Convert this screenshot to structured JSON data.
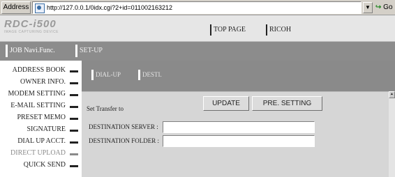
{
  "browser": {
    "address_label": "Address",
    "url": "http://127.0.0.1/0idx.cgi?2+id=011002163212",
    "go_label": "Go"
  },
  "header": {
    "logo_text": "RDC-i500",
    "logo_subtext": "IMAGE CAPTURING DEVICE",
    "links": [
      "TOP PAGE",
      "RICOH"
    ]
  },
  "nav": {
    "items": [
      "JOB Navi.Func.",
      "SET-UP"
    ]
  },
  "sidebar": {
    "items": [
      {
        "label": "ADDRESS BOOK",
        "enabled": true
      },
      {
        "label": "OWNER INFO.",
        "enabled": true
      },
      {
        "label": "MODEM SETTING",
        "enabled": true
      },
      {
        "label": "E-MAIL SETTING",
        "enabled": true
      },
      {
        "label": "PRESET MEMO",
        "enabled": true
      },
      {
        "label": "SIGNATURE",
        "enabled": true
      },
      {
        "label": "DIAL UP ACCT.",
        "enabled": true
      },
      {
        "label": "DIRECT UPLOAD",
        "enabled": false
      },
      {
        "label": "QUICK SEND",
        "enabled": true
      }
    ]
  },
  "content": {
    "subtabs": [
      "DIAL-UP",
      "DESTI."
    ],
    "transfer_label": "Set Transfer to",
    "buttons": {
      "update": "UPDATE",
      "pre_setting": "PRE. SETTING"
    },
    "fields": [
      {
        "label": "DESTINATION SERVER :",
        "value": "",
        "placeholder": ""
      },
      {
        "label": "DESTINATION FOLDER :",
        "value": "",
        "placeholder": ""
      }
    ]
  },
  "colors": {
    "nav_bar": "#8c8c8c",
    "content_bg": "#d6d6d6",
    "disabled_text": "#8a8a8a"
  }
}
